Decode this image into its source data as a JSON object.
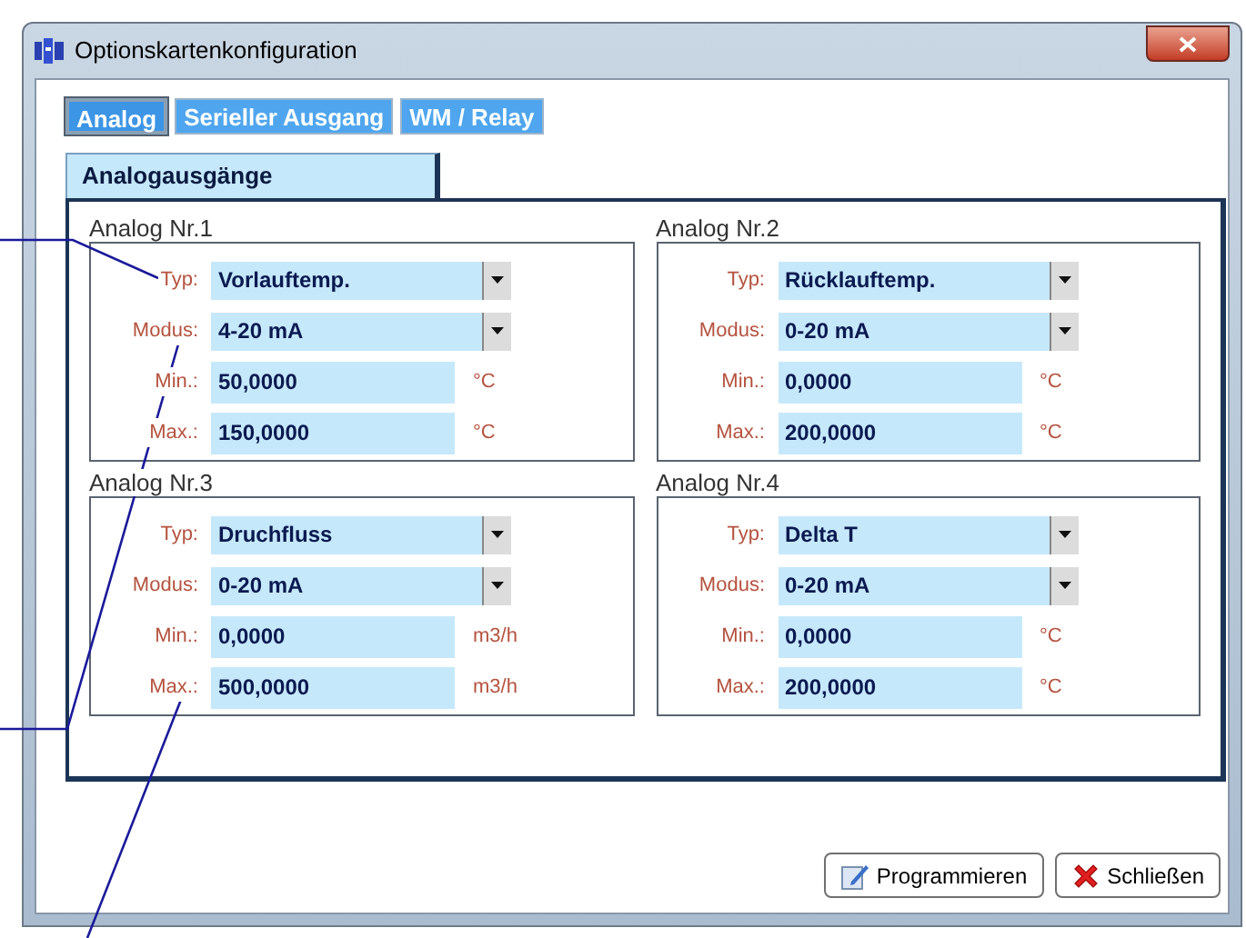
{
  "window": {
    "title": "Optionskartenkonfiguration"
  },
  "tabs": [
    {
      "label": "Analog",
      "selected": true
    },
    {
      "label": "Serieller Ausgang",
      "selected": false
    },
    {
      "label": "WM / Relay",
      "selected": false
    }
  ],
  "section_tab": "Analogausgänge",
  "groups": [
    {
      "title": "Analog Nr.1",
      "rows": [
        {
          "kind": "combo",
          "label": "Typ:",
          "value": "Vorlauftemp."
        },
        {
          "kind": "combo",
          "label": "Modus:",
          "value": "4-20 mA"
        },
        {
          "kind": "field",
          "label": "Min.:",
          "value": "50,0000",
          "unit": "°C"
        },
        {
          "kind": "field",
          "label": "Max.:",
          "value": "150,0000",
          "unit": "°C"
        }
      ]
    },
    {
      "title": "Analog Nr.2",
      "rows": [
        {
          "kind": "combo",
          "label": "Typ:",
          "value": "Rücklauftemp."
        },
        {
          "kind": "combo",
          "label": "Modus:",
          "value": "0-20 mA"
        },
        {
          "kind": "field",
          "label": "Min.:",
          "value": "0,0000",
          "unit": "°C"
        },
        {
          "kind": "field",
          "label": "Max.:",
          "value": "200,0000",
          "unit": "°C"
        }
      ]
    },
    {
      "title": "Analog Nr.3",
      "rows": [
        {
          "kind": "combo",
          "label": "Typ:",
          "value": "Druchfluss"
        },
        {
          "kind": "combo",
          "label": "Modus:",
          "value": "0-20 mA"
        },
        {
          "kind": "field",
          "label": "Min.:",
          "value": "0,0000",
          "unit": "m3/h"
        },
        {
          "kind": "field",
          "label": "Max.:",
          "value": "500,0000",
          "unit": "m3/h"
        }
      ]
    },
    {
      "title": "Analog Nr.4",
      "rows": [
        {
          "kind": "combo",
          "label": "Typ:",
          "value": "Delta T"
        },
        {
          "kind": "combo",
          "label": "Modus:",
          "value": "0-20 mA"
        },
        {
          "kind": "field",
          "label": "Min.:",
          "value": "0,0000",
          "unit": "°C"
        },
        {
          "kind": "field",
          "label": "Max.:",
          "value": "200,0000",
          "unit": "°C"
        }
      ]
    }
  ],
  "buttons": [
    {
      "kind": "program",
      "label": "Programmieren"
    },
    {
      "kind": "close",
      "label": "Schließen"
    }
  ]
}
